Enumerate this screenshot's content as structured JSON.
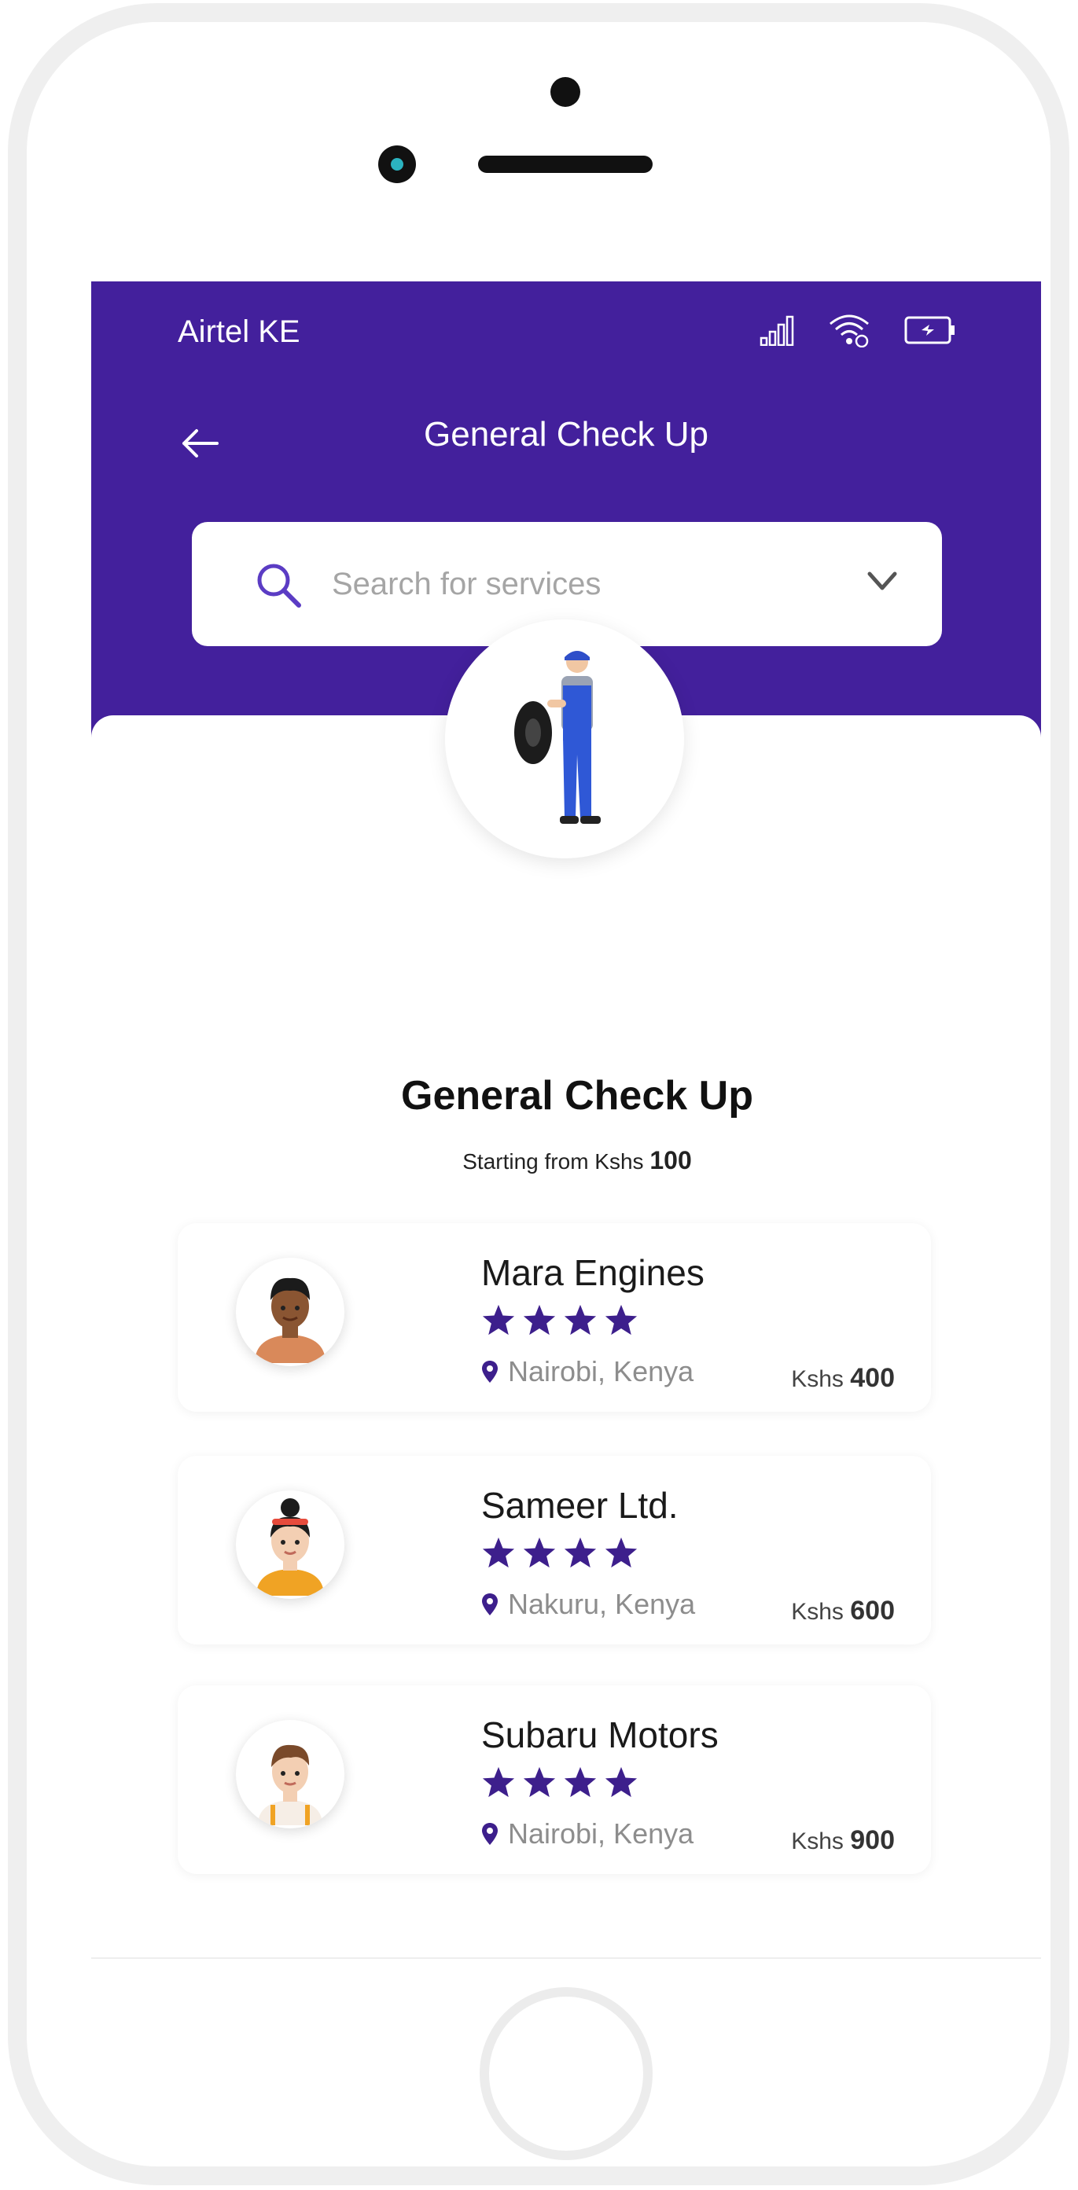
{
  "status_bar": {
    "carrier": "Airtel KE",
    "icons": [
      "signal-icon",
      "wifi-icon",
      "battery-icon"
    ]
  },
  "header": {
    "title": "General Check Up",
    "back_icon": "back-arrow-icon"
  },
  "search": {
    "placeholder": "Search for services",
    "value": ""
  },
  "service": {
    "title": "General Check Up",
    "starting_prefix": "Starting from Kshs",
    "starting_price": "100"
  },
  "providers": [
    {
      "name": "Mara Engines",
      "rating": 4,
      "location": "Nairobi, Kenya",
      "currency": "Kshs",
      "price": "400"
    },
    {
      "name": "Sameer Ltd.",
      "rating": 4,
      "location": "Nakuru, Kenya",
      "currency": "Kshs",
      "price": "600"
    },
    {
      "name": "Subaru Motors",
      "rating": 4,
      "location": "Nairobi, Kenya",
      "currency": "Kshs",
      "price": "900"
    }
  ],
  "colors": {
    "brand": "#43209c",
    "star": "#3d1f8c",
    "frame": "#efefef"
  }
}
